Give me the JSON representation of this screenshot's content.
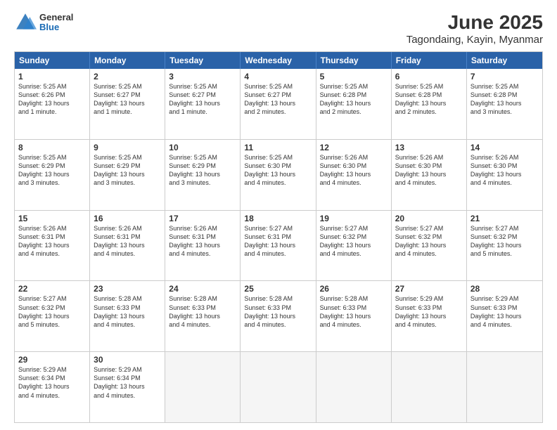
{
  "logo": {
    "general": "General",
    "blue": "Blue"
  },
  "title": "June 2025",
  "subtitle": "Tagondaing, Kayin, Myanmar",
  "days": [
    "Sunday",
    "Monday",
    "Tuesday",
    "Wednesday",
    "Thursday",
    "Friday",
    "Saturday"
  ],
  "rows": [
    [
      {
        "day": "1",
        "info": "Sunrise: 5:25 AM\nSunset: 6:26 PM\nDaylight: 13 hours\nand 1 minute."
      },
      {
        "day": "2",
        "info": "Sunrise: 5:25 AM\nSunset: 6:27 PM\nDaylight: 13 hours\nand 1 minute."
      },
      {
        "day": "3",
        "info": "Sunrise: 5:25 AM\nSunset: 6:27 PM\nDaylight: 13 hours\nand 1 minute."
      },
      {
        "day": "4",
        "info": "Sunrise: 5:25 AM\nSunset: 6:27 PM\nDaylight: 13 hours\nand 2 minutes."
      },
      {
        "day": "5",
        "info": "Sunrise: 5:25 AM\nSunset: 6:28 PM\nDaylight: 13 hours\nand 2 minutes."
      },
      {
        "day": "6",
        "info": "Sunrise: 5:25 AM\nSunset: 6:28 PM\nDaylight: 13 hours\nand 2 minutes."
      },
      {
        "day": "7",
        "info": "Sunrise: 5:25 AM\nSunset: 6:28 PM\nDaylight: 13 hours\nand 3 minutes."
      }
    ],
    [
      {
        "day": "8",
        "info": "Sunrise: 5:25 AM\nSunset: 6:29 PM\nDaylight: 13 hours\nand 3 minutes."
      },
      {
        "day": "9",
        "info": "Sunrise: 5:25 AM\nSunset: 6:29 PM\nDaylight: 13 hours\nand 3 minutes."
      },
      {
        "day": "10",
        "info": "Sunrise: 5:25 AM\nSunset: 6:29 PM\nDaylight: 13 hours\nand 3 minutes."
      },
      {
        "day": "11",
        "info": "Sunrise: 5:25 AM\nSunset: 6:30 PM\nDaylight: 13 hours\nand 4 minutes."
      },
      {
        "day": "12",
        "info": "Sunrise: 5:26 AM\nSunset: 6:30 PM\nDaylight: 13 hours\nand 4 minutes."
      },
      {
        "day": "13",
        "info": "Sunrise: 5:26 AM\nSunset: 6:30 PM\nDaylight: 13 hours\nand 4 minutes."
      },
      {
        "day": "14",
        "info": "Sunrise: 5:26 AM\nSunset: 6:30 PM\nDaylight: 13 hours\nand 4 minutes."
      }
    ],
    [
      {
        "day": "15",
        "info": "Sunrise: 5:26 AM\nSunset: 6:31 PM\nDaylight: 13 hours\nand 4 minutes."
      },
      {
        "day": "16",
        "info": "Sunrise: 5:26 AM\nSunset: 6:31 PM\nDaylight: 13 hours\nand 4 minutes."
      },
      {
        "day": "17",
        "info": "Sunrise: 5:26 AM\nSunset: 6:31 PM\nDaylight: 13 hours\nand 4 minutes."
      },
      {
        "day": "18",
        "info": "Sunrise: 5:27 AM\nSunset: 6:31 PM\nDaylight: 13 hours\nand 4 minutes."
      },
      {
        "day": "19",
        "info": "Sunrise: 5:27 AM\nSunset: 6:32 PM\nDaylight: 13 hours\nand 4 minutes."
      },
      {
        "day": "20",
        "info": "Sunrise: 5:27 AM\nSunset: 6:32 PM\nDaylight: 13 hours\nand 4 minutes."
      },
      {
        "day": "21",
        "info": "Sunrise: 5:27 AM\nSunset: 6:32 PM\nDaylight: 13 hours\nand 5 minutes."
      }
    ],
    [
      {
        "day": "22",
        "info": "Sunrise: 5:27 AM\nSunset: 6:32 PM\nDaylight: 13 hours\nand 5 minutes."
      },
      {
        "day": "23",
        "info": "Sunrise: 5:28 AM\nSunset: 6:33 PM\nDaylight: 13 hours\nand 4 minutes."
      },
      {
        "day": "24",
        "info": "Sunrise: 5:28 AM\nSunset: 6:33 PM\nDaylight: 13 hours\nand 4 minutes."
      },
      {
        "day": "25",
        "info": "Sunrise: 5:28 AM\nSunset: 6:33 PM\nDaylight: 13 hours\nand 4 minutes."
      },
      {
        "day": "26",
        "info": "Sunrise: 5:28 AM\nSunset: 6:33 PM\nDaylight: 13 hours\nand 4 minutes."
      },
      {
        "day": "27",
        "info": "Sunrise: 5:29 AM\nSunset: 6:33 PM\nDaylight: 13 hours\nand 4 minutes."
      },
      {
        "day": "28",
        "info": "Sunrise: 5:29 AM\nSunset: 6:33 PM\nDaylight: 13 hours\nand 4 minutes."
      }
    ],
    [
      {
        "day": "29",
        "info": "Sunrise: 5:29 AM\nSunset: 6:34 PM\nDaylight: 13 hours\nand 4 minutes."
      },
      {
        "day": "30",
        "info": "Sunrise: 5:29 AM\nSunset: 6:34 PM\nDaylight: 13 hours\nand 4 minutes."
      },
      {
        "day": "",
        "info": ""
      },
      {
        "day": "",
        "info": ""
      },
      {
        "day": "",
        "info": ""
      },
      {
        "day": "",
        "info": ""
      },
      {
        "day": "",
        "info": ""
      }
    ]
  ]
}
